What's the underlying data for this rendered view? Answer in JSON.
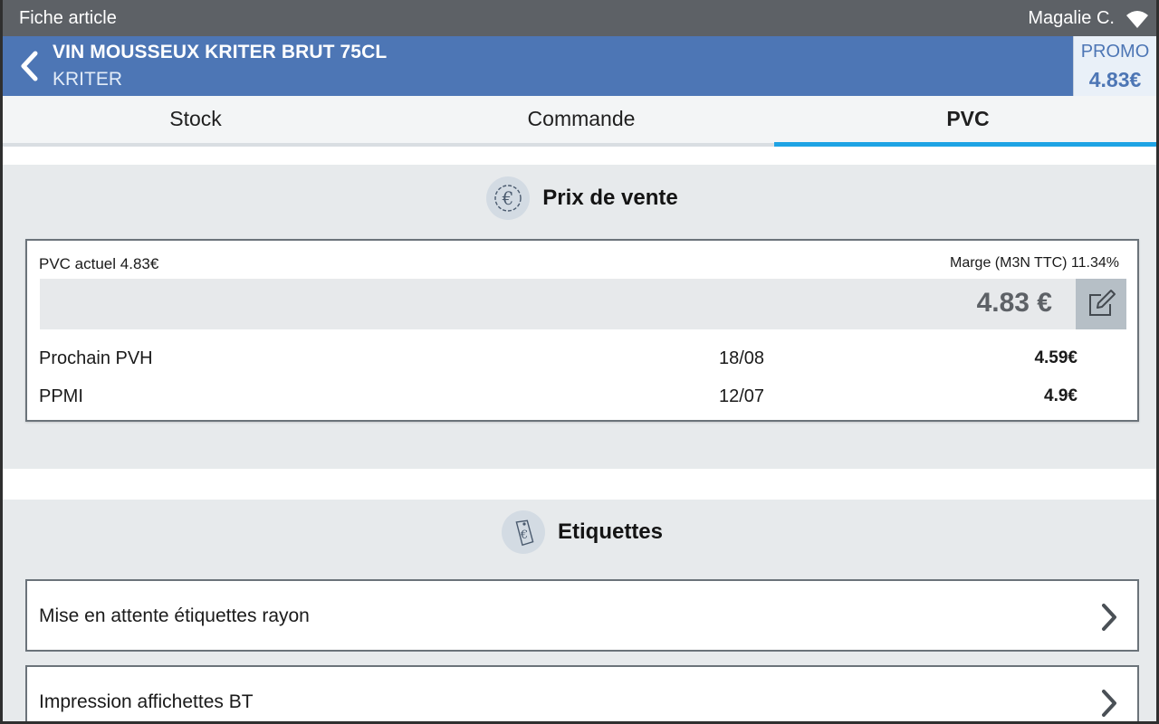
{
  "status_bar": {
    "title": "Fiche article",
    "user": "Magalie C.",
    "wifi_icon": "wifi-icon"
  },
  "header": {
    "product_name": "VIN MOUSSEUX KRITER BRUT 75CL",
    "brand": "KRITER",
    "promo_label": "PROMO",
    "promo_price": "4.83€",
    "back_icon": "chevron-left-icon"
  },
  "tabs": [
    {
      "label": "Stock",
      "active": false
    },
    {
      "label": "Commande",
      "active": false
    },
    {
      "label": "PVC",
      "active": true
    }
  ],
  "prix_de_vente": {
    "title": "Prix de vente",
    "icon": "euro-icon",
    "pvc_actuel": "PVC actuel 4.83€",
    "marge": "Marge (M3N TTC) 11.34%",
    "price_value": "4.83 €",
    "edit_icon": "edit-icon",
    "rows": [
      {
        "label": "Prochain PVH",
        "date": "18/08",
        "value": "4.59€"
      },
      {
        "label": "PPMI",
        "date": "12/07",
        "value": "4.9€"
      }
    ]
  },
  "etiquettes": {
    "title": "Etiquettes",
    "icon": "price-tag-icon",
    "items": [
      {
        "label": "Mise en attente étiquettes rayon"
      },
      {
        "label": "Impression affichettes BT"
      }
    ]
  },
  "colors": {
    "header_blue": "#4d76b5",
    "status_bar": "#5d6166",
    "tab_active_underline": "#1ea3e4",
    "section_bg": "#e7eaec"
  }
}
